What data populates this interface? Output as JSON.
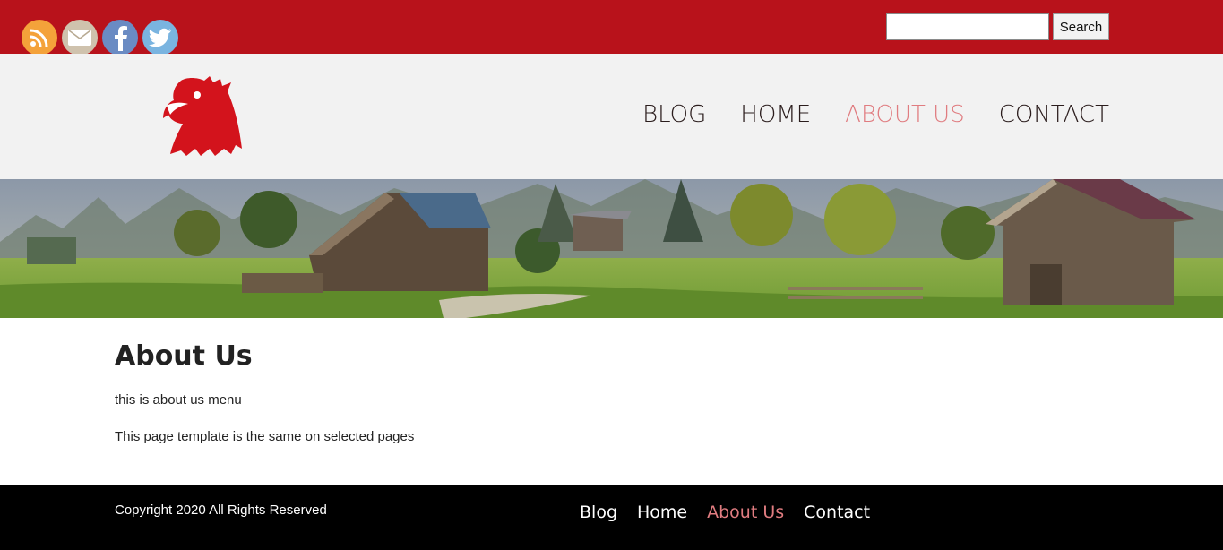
{
  "social": {
    "icons": [
      "rss-icon",
      "mail-icon",
      "facebook-icon",
      "twitter-icon"
    ],
    "colors": {
      "rss": "#f4a23a",
      "mail": "#cfc2ad",
      "facebook": "#6a8bc3",
      "twitter": "#7ab4e0"
    }
  },
  "search": {
    "value": "",
    "placeholder": "",
    "button_label": "Search"
  },
  "nav": {
    "items": [
      {
        "label": "BLOG"
      },
      {
        "label": "HOME"
      },
      {
        "label": "ABOUT US",
        "active": true
      },
      {
        "label": "CONTACT"
      }
    ]
  },
  "page": {
    "title": "About Us",
    "paragraphs": [
      "this is about us menu",
      "This page template is the same on selected pages"
    ]
  },
  "footer": {
    "copyright": "Copyright 2020 All Rights Reserved",
    "nav": [
      {
        "label": "Blog"
      },
      {
        "label": "Home"
      },
      {
        "label": "About Us",
        "active": true
      },
      {
        "label": "Contact"
      }
    ]
  },
  "colors": {
    "topbar": "#b8121b",
    "header_bg": "#f2f2f2",
    "active_link": "#e07c80",
    "footer_bg": "#000000",
    "logo": "#d3131c"
  }
}
